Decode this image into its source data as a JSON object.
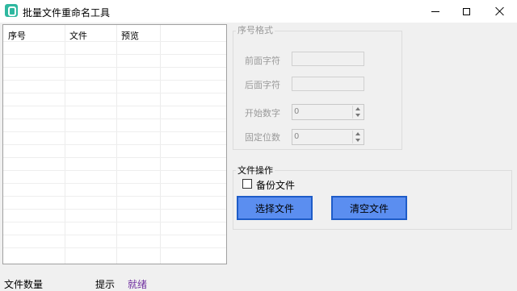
{
  "window": {
    "title": "批量文件重命名工具",
    "icon": "app-icon"
  },
  "file_list": {
    "columns": [
      "序号",
      "文件",
      "预览"
    ],
    "rows": []
  },
  "sequence_format": {
    "group_title": "序号格式",
    "prefix_label": "前面字符",
    "prefix_value": "",
    "suffix_label": "后面字符",
    "suffix_value": "",
    "start_label": "开始数字",
    "start_value": "0",
    "digits_label": "固定位数",
    "digits_value": "0"
  },
  "file_ops": {
    "group_title": "文件操作",
    "backup_label": "备份文件",
    "backup_checked": false,
    "select_button": "选择文件",
    "clear_button": "清空文件"
  },
  "status": {
    "file_count_label": "文件数量",
    "tip_label": "提示",
    "tip_value": "就绪",
    "tip_color": "#7030a0"
  },
  "colors": {
    "button_fill": "#5b8ef0",
    "button_border": "#1e5cc8"
  }
}
